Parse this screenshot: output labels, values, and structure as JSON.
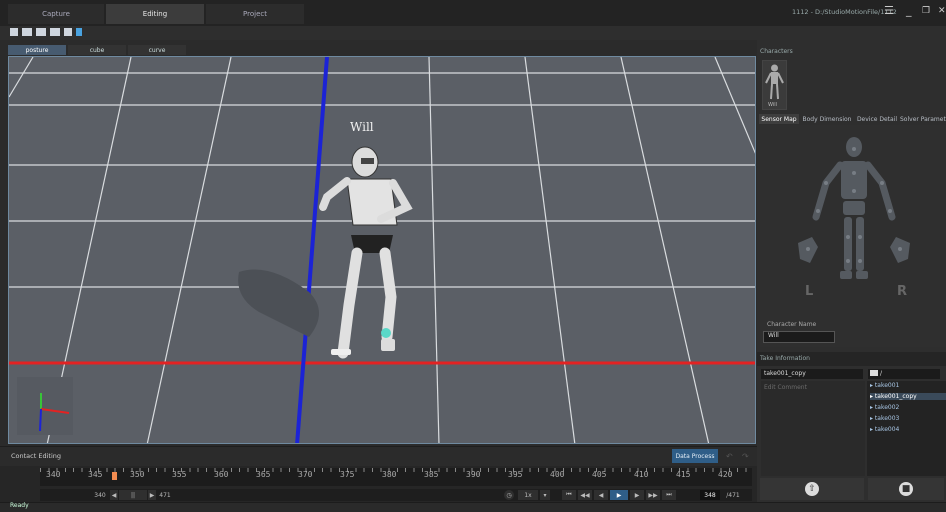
{
  "titlebar": {
    "tabs": [
      "Capture",
      "Editing",
      "Project"
    ],
    "active_tab": "Editing",
    "path": "1112 - D:/StudioMotionFile/1112",
    "menu_icon": "hamburger-icon",
    "minimize_icon": "minimize-icon",
    "restore_icon": "restore-icon",
    "close_icon": "close-icon"
  },
  "subtabs": [
    "posture",
    "cube",
    "curve"
  ],
  "viewport": {
    "character_name": "Will"
  },
  "contact": {
    "label": "Contact Editing",
    "data_process": "Data Process"
  },
  "timeline": {
    "ticks": [
      "340",
      "345",
      "350",
      "355",
      "360",
      "365",
      "370",
      "375",
      "380",
      "385",
      "390",
      "395",
      "400",
      "405",
      "410",
      "415",
      "420"
    ],
    "range_start": "340",
    "range_end": "471",
    "speed": "1x",
    "current_frame": "348",
    "total_frames": "/471"
  },
  "status": "Ready",
  "right": {
    "characters_header": "Characters",
    "character_thumb_label": "Will",
    "tabs": [
      "Sensor Map",
      "Body Dimension",
      "Device Detail",
      "Solver Parameter"
    ],
    "left_label": "L",
    "right_label": "R",
    "character_name_label": "Character Name",
    "character_name_value": "Will",
    "take_info_header": "Take Information",
    "take_name": "take001_copy",
    "folder": "/",
    "comment_placeholder": "Edit Comment",
    "takes": [
      "take001",
      "take001_copy",
      "take002",
      "take003",
      "take004"
    ],
    "selected_take": "take001_copy"
  },
  "colors": {
    "accent": "#2f5e88",
    "axis_red": "#e32222",
    "axis_blue": "#1c23d6",
    "axis_green": "#38c438"
  }
}
